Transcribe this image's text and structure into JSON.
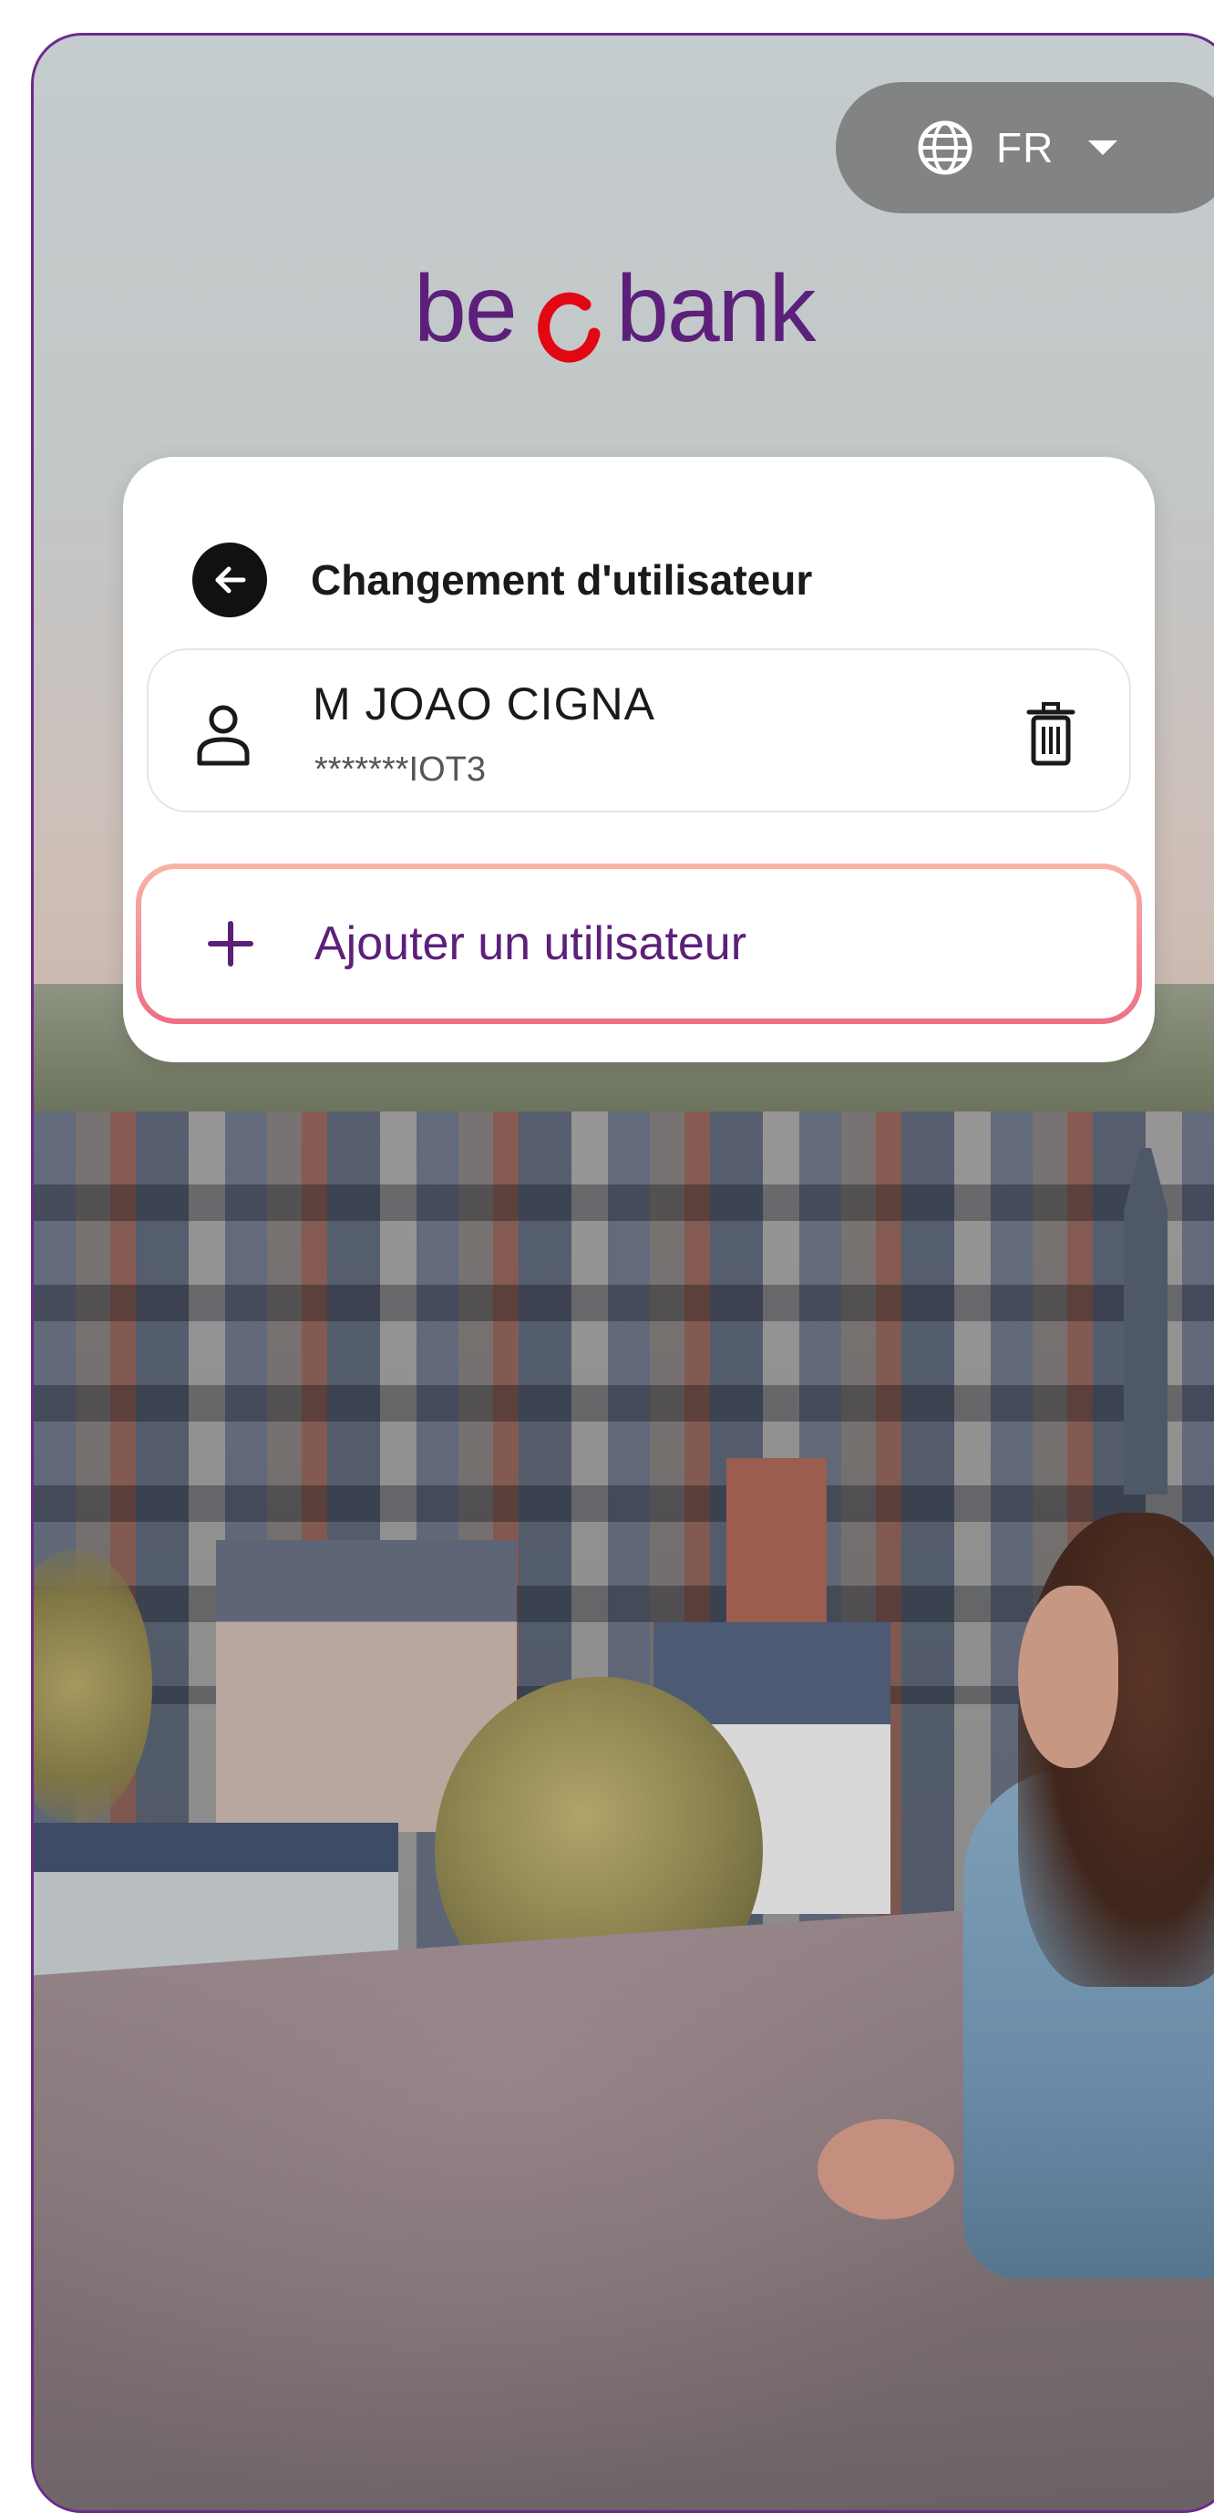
{
  "language": {
    "current": "FR",
    "icon": "globe-icon",
    "dropdown_icon": "caret-down-icon"
  },
  "brand": {
    "logo_text": "beobank",
    "logo_color": "#5c1f7a",
    "logo_accent_color": "#e30613"
  },
  "user_switch": {
    "title": "Changement d'utilisateur",
    "back_icon": "arrow-left-icon",
    "users": [
      {
        "name": "M JOAO CIGNA",
        "masked_id": "*******IOT3",
        "icon": "user-icon",
        "delete_icon": "trash-icon"
      }
    ],
    "add_user": {
      "label": "Ajouter un utilisateur",
      "icon": "plus-icon",
      "highlight_color": "#ee6e86"
    }
  },
  "colors": {
    "frame_border": "#6b2a8c",
    "accent": "#5c1f7a"
  }
}
